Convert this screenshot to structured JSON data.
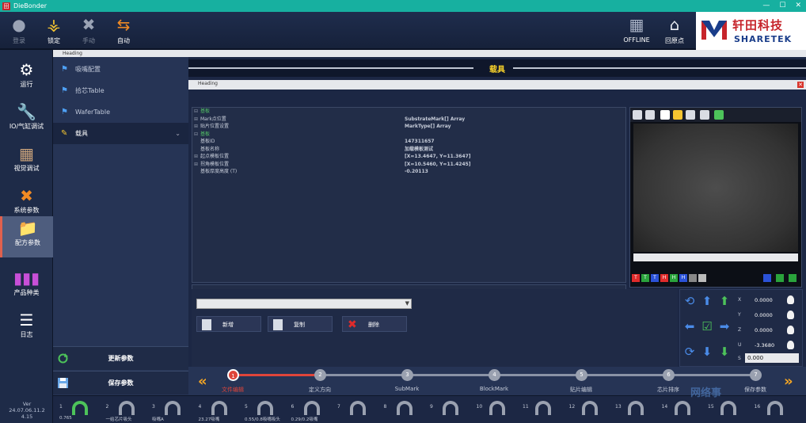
{
  "window": {
    "title": "DieBonder",
    "app_icon_letter": "田",
    "controls": [
      "—",
      "☐",
      "✕"
    ]
  },
  "toolbar": {
    "buttons": [
      {
        "label": "登录",
        "icon": "user-icon",
        "disabled": true
      },
      {
        "label": "锁定",
        "icon": "key-icon",
        "disabled": false
      },
      {
        "label": "手动",
        "icon": "tools-icon",
        "disabled": true
      },
      {
        "label": "自动",
        "icon": "auto-icon",
        "disabled": false
      }
    ],
    "right_buttons": [
      {
        "label": "OFFLINE",
        "icon": "network-icon"
      },
      {
        "label": "回原点",
        "icon": "home-icon"
      }
    ],
    "logo": {
      "cn": "轩田科技",
      "en": "SHARETEK"
    }
  },
  "leftnav": {
    "items": [
      {
        "label": "运行",
        "icon": "gears-icon"
      },
      {
        "label": "IO/气缸调试",
        "icon": "wrench-icon"
      },
      {
        "label": "视觉调试",
        "icon": "camera-icon"
      },
      {
        "label": "系统参数",
        "icon": "cross-tools-icon"
      },
      {
        "label": "配方参数",
        "icon": "folder-icon",
        "active": true
      },
      {
        "label": "产品种类",
        "icon": "bars-icon"
      },
      {
        "label": "日志",
        "icon": "database-icon"
      }
    ],
    "version_line1": "Ver",
    "version_line2": "24.07.06.11.2",
    "version_line3": "4.15"
  },
  "subnav": {
    "header": "Heading",
    "items": [
      {
        "label": "吸嘴配置"
      },
      {
        "label": "拾芯Table"
      },
      {
        "label": "WaferTable"
      },
      {
        "label": "载具",
        "active": true
      }
    ],
    "update_button": "更新参数",
    "save_button": "保存参数"
  },
  "main": {
    "section_title": "载具",
    "inner_header": "Heading",
    "close_icon": "✕",
    "properties": [
      {
        "expander": "⊟",
        "key": "基板",
        "value": "",
        "group": true
      },
      {
        "expander": "⊞",
        "key": "Mark点位置",
        "value": "SubstrateMark[] Array"
      },
      {
        "expander": "⊞",
        "key": "贴片位置设置",
        "value": "MarkType[] Array"
      },
      {
        "expander": "⊟",
        "key": "基板",
        "value": "",
        "group": true
      },
      {
        "expander": "",
        "key": "基板ID",
        "value": "147311657"
      },
      {
        "expander": "",
        "key": "基板名称",
        "value": "加载模板测试"
      },
      {
        "expander": "⊞",
        "key": "起点模板位置",
        "value": "[X=13.4647, Y=11.3647]"
      },
      {
        "expander": "⊞",
        "key": "拐角模板位置",
        "value": "[X=10.5460, Y=11.4245]"
      },
      {
        "expander": "",
        "key": "基板厚度高度 (T)",
        "value": "-0.20113"
      }
    ],
    "description": "基板名称",
    "combo_value": "",
    "actions": [
      {
        "label": "新增"
      },
      {
        "label": "复制"
      },
      {
        "label": "删除",
        "danger": true
      }
    ]
  },
  "camera": {
    "color_buttons": [
      "T",
      "T",
      "T",
      "H",
      "H",
      "H"
    ]
  },
  "jog": {
    "axes": [
      {
        "name": "X",
        "value": "0.0000"
      },
      {
        "name": "Y",
        "value": "0.0000"
      },
      {
        "name": "Z",
        "value": "0.0000"
      },
      {
        "name": "U",
        "value": "-3.3680"
      }
    ],
    "step_label": "S",
    "step_value": "0.000"
  },
  "wizard": {
    "prev": "«",
    "next": "»",
    "steps": [
      {
        "n": "1",
        "label": "文件编辑",
        "current": true
      },
      {
        "n": "2",
        "label": "定义方向"
      },
      {
        "n": "3",
        "label": "SubMark"
      },
      {
        "n": "4",
        "label": "BlockMark"
      },
      {
        "n": "5",
        "label": "贴片编辑"
      },
      {
        "n": "6",
        "label": "芯片排序"
      },
      {
        "n": "7",
        "label": "保存参数"
      }
    ]
  },
  "stations": [
    {
      "n": "1",
      "label": "0.765",
      "on": true
    },
    {
      "n": "2",
      "label": "一给芯片吸头"
    },
    {
      "n": "3",
      "label": "吸嘴A"
    },
    {
      "n": "4",
      "label": "23.27吸嘴"
    },
    {
      "n": "5",
      "label": "0.55/0.8吸嘴吸头"
    },
    {
      "n": "6",
      "label": "0.29/0.2吸嘴"
    },
    {
      "n": "7",
      "label": ""
    },
    {
      "n": "8",
      "label": ""
    },
    {
      "n": "9",
      "label": ""
    },
    {
      "n": "10",
      "label": ""
    },
    {
      "n": "11",
      "label": ""
    },
    {
      "n": "12",
      "label": ""
    },
    {
      "n": "13",
      "label": ""
    },
    {
      "n": "14",
      "label": ""
    },
    {
      "n": "15",
      "label": ""
    },
    {
      "n": "16",
      "label": ""
    }
  ],
  "watermark": "网络事"
}
